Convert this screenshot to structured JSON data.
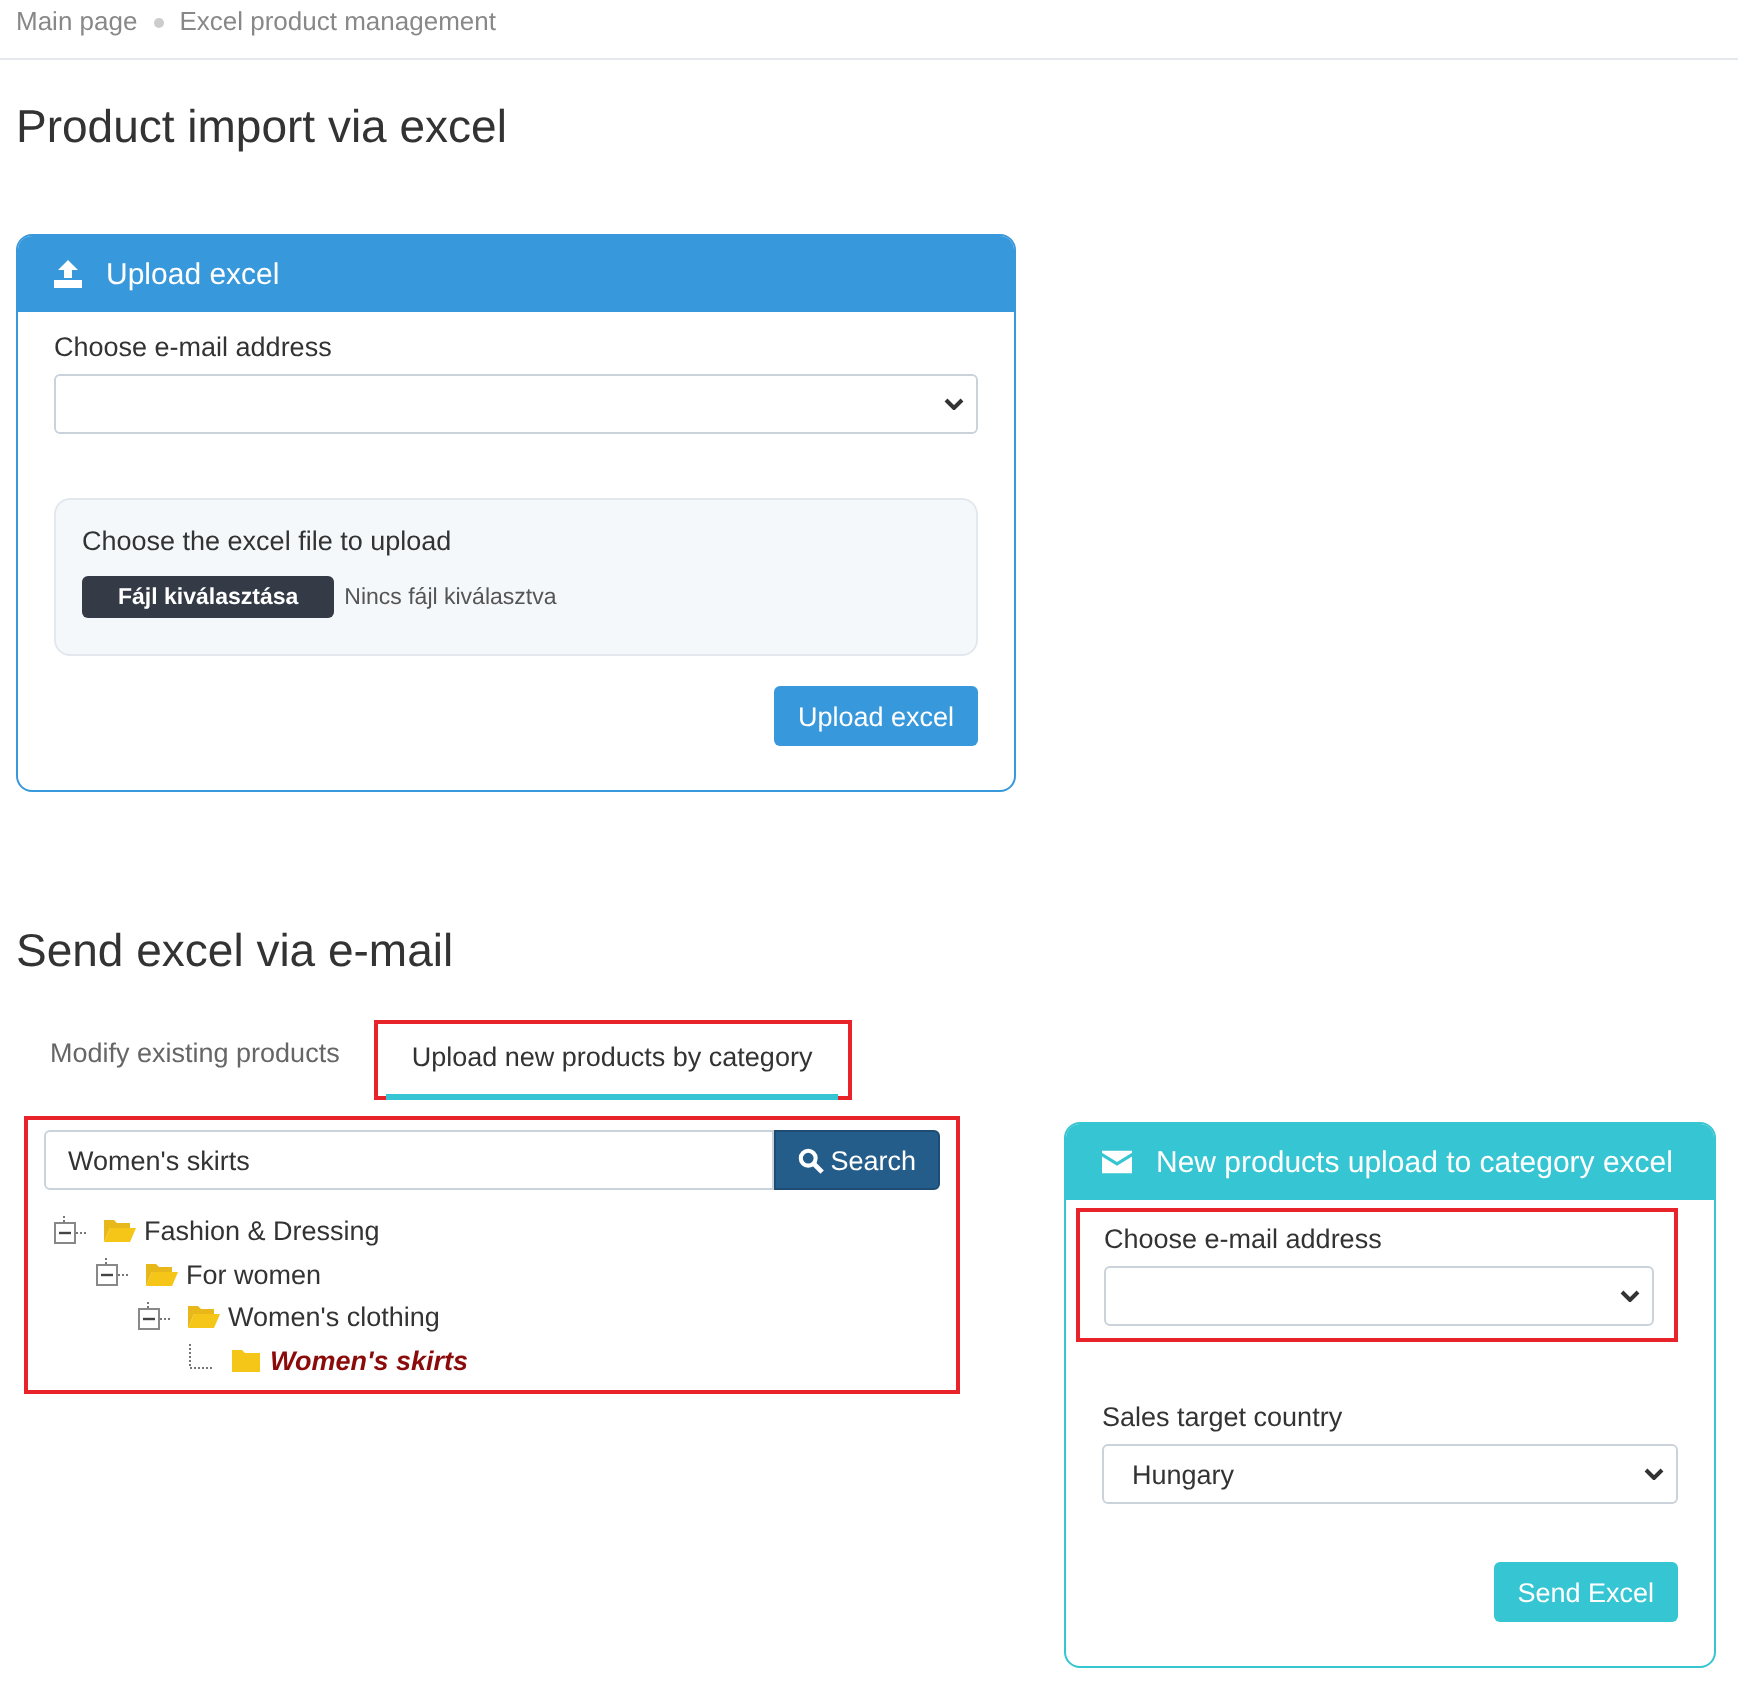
{
  "breadcrumb": [
    {
      "label": "Main page"
    },
    {
      "label": "Excel product management"
    }
  ],
  "page_title": "Product import via excel",
  "upload_card": {
    "title": "Upload excel",
    "email_label": "Choose e-mail address",
    "file_label": "Choose the excel file to upload",
    "file_button": "Fájl kiválasztása",
    "file_status": "Nincs fájl kiválasztva",
    "submit": "Upload excel"
  },
  "section_title": "Send excel via e-mail",
  "tabs": [
    {
      "label": "Modify existing products",
      "selected": false,
      "highlighted": false
    },
    {
      "label": "Upload new products by category",
      "selected": true,
      "highlighted": true
    }
  ],
  "category_panel": {
    "highlighted": true,
    "search": {
      "value": "Women's skirts",
      "button": "Search"
    },
    "tree": [
      {
        "label": "Fashion & Dressing",
        "expanded": true,
        "selected": false,
        "children": [
          {
            "label": "For women",
            "expanded": true,
            "selected": false,
            "children": [
              {
                "label": "Women's clothing",
                "expanded": true,
                "selected": false,
                "children": [
                  {
                    "label": "Women's skirts",
                    "expanded": false,
                    "selected": true
                  }
                ]
              }
            ]
          }
        ]
      }
    ]
  },
  "email_card": {
    "title": "New products upload to category excel",
    "email_label": "Choose e-mail address",
    "email_highlighted": true,
    "country_label": "Sales target country",
    "country_value": "Hungary",
    "submit": "Send Excel"
  }
}
